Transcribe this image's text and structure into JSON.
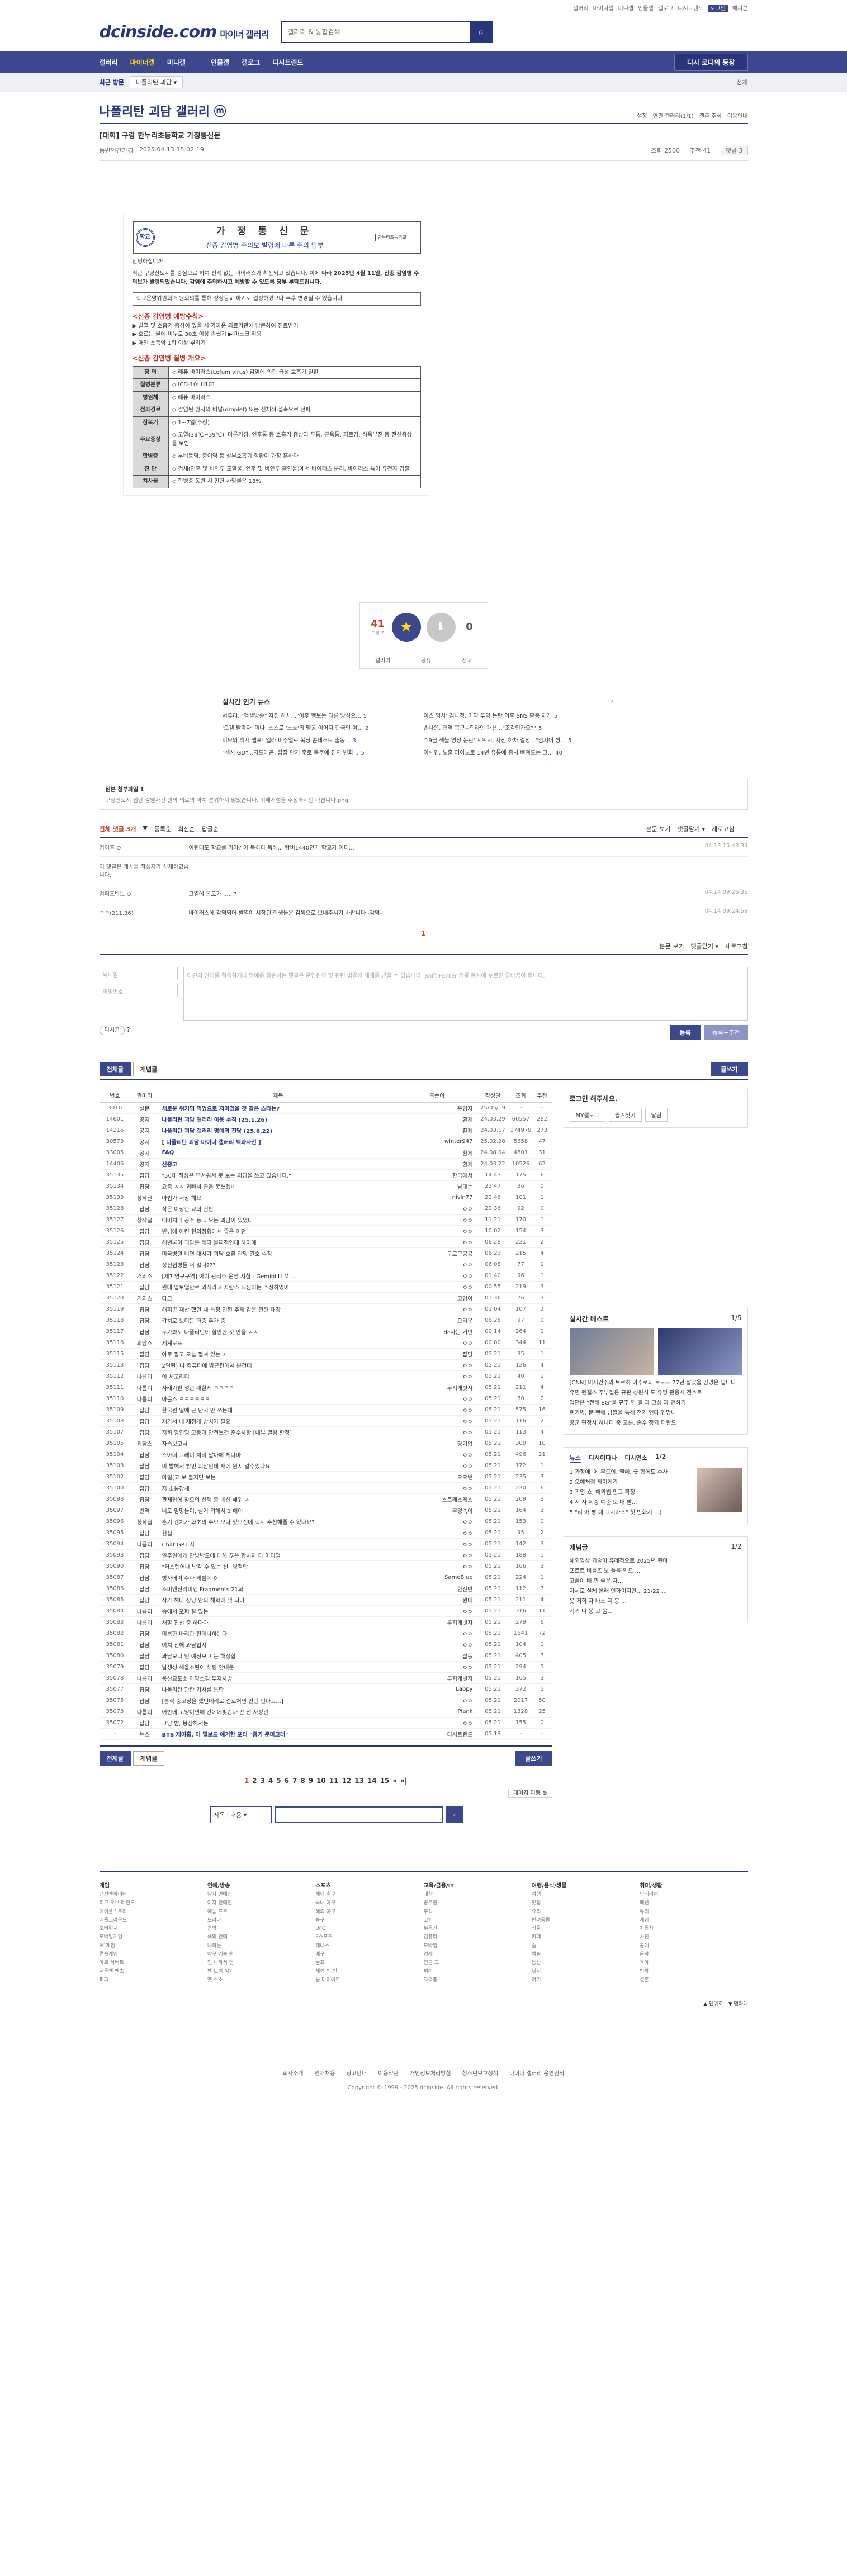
{
  "util": [
    "갤러리",
    "마이너갤",
    "미니갤",
    "인물갤",
    "갤로그",
    "디시트렌드",
    "로그인",
    "해피콘"
  ],
  "header": {
    "logo": "dcinside.com",
    "logo_sub": "마이너 갤러리",
    "search_placeholder": "갤러리 & 통합검색"
  },
  "gnb": {
    "items": [
      "갤러리",
      "마이너갤",
      "미니갤",
      "인물갤",
      "갤로그",
      "디시트렌드"
    ],
    "right": "디시 로디의 등장"
  },
  "subbar": {
    "label": "최근 방문",
    "dropdown": "나폴리탄 괴담 ▾",
    "right": "전체"
  },
  "gallery": {
    "title": "나폴리탄 괴담 갤러리",
    "badge": "ⓜ",
    "opts": [
      "설정",
      "연관 갤러리(1/1)",
      "갤주 주식",
      "이용안내"
    ]
  },
  "post": {
    "title": "[대회] 구랑 한누리초등학교 가정통신문",
    "author": "동반인간가경",
    "date": "2025.04.13 15:02:19",
    "views": "조회 2500",
    "recs": "추천 41",
    "cmt_btn": "댓글 3"
  },
  "doc": {
    "seal": "학교",
    "paper": "가 정 통 신 문",
    "sub": "신종 감염병 주의보 발령에 따른 주의 당부",
    "side": "한누리초등학교",
    "greet": "안녕하십니까",
    "p1": "최근 구랑산도시를 중심으로 하여 전례 없는 바이러스가 확산되고 있습니다. 이에 따라",
    "p1b": "2025년 4월 11일, 신종 감염병 주의보가 발령되었습니다. 감염에 주의하시고 예방할 수 있도록 당부 부탁드립니다.",
    "box": "학교운영위원회 위원회의를 통해 정상등교 하기로 결정하였으나 추후 변경될 수 있습니다.",
    "h1": "<신종 감염병 예방수칙>",
    "rules": [
      "▶ 발열 및 호흡기 증상이 있을 시 가까운 의료기관에 방문하여 진료받기",
      "▶ 흐르는 물에 비누로 30초 이상 손씻기 ▶ 마스크 착용",
      "▶ 매일 소독약 1회 이상 뿌리기"
    ],
    "h2": "<신종 감염병 질병 개요>",
    "table": [
      [
        "정 의",
        "◇ 레퓨 바이러스(Lefum virus) 감염에 의한 급성 호흡기 질환"
      ],
      [
        "질병분류",
        "◇ ICD-10: U101"
      ],
      [
        "병원체",
        "◇ 레퓨 바이러스"
      ],
      [
        "전파경로",
        "◇ 감염된 환자의 비말(droplet) 또는 신체적 접촉으로 전파"
      ],
      [
        "잠복기",
        "◇ 1~7일(추정)"
      ],
      [
        "주요증상",
        "◇ 고열(38℃~39℃), 마른기침, 인후통 등 호흡기 증상과 두통, 근육통, 피로감, 식욕부진 등 전신증상을 보임"
      ],
      [
        "합병증",
        "◇ 부비동염, 중이염 등 상부호흡기 질환이 가장 흔하다"
      ],
      [
        "진 단",
        "◇ 검체(인후 및 비인두 도말물, 인후 및 비인두 흡인물)에서 바이러스 분리, 바이러스 특이 유전자 검출"
      ],
      [
        "치사율",
        "◇ 합병증 동반 시 인한 사망률은 18%"
      ]
    ]
  },
  "rec": {
    "up": "41",
    "up_sub": "고정 7",
    "down": "0",
    "up_label": "개념",
    "acts": [
      "갤러리",
      "공유",
      "신고"
    ]
  },
  "news": {
    "title": "실시간 인기 뉴스",
    "items": [
      {
        "t": "서유리, \"액셀방송\" 자진 하차...\"이후 행보는 다른 방식으...",
        "c": "5"
      },
      {
        "t": "이스 역사' 김나정, 마약 투약 논란 이후 SNS 활동 재개",
        "c": "5"
      },
      {
        "t": "'오겜 탈락자' 미나, 스스로 '노쇼'의 맹공 이어져 한국인 여...",
        "c": "2"
      },
      {
        "t": "손나은, 현역 복근+힙라인 패션...\"조각인가요?\"",
        "c": "5"
      },
      {
        "t": "미모의 섹시 엘프! 엘라 비주얼로 복싱 콘테스트 출동...",
        "c": "3"
      },
      {
        "t": "'19금 섹블 영상 논란' 시위지, 자진 하차 결정...\"심지어 쌍...",
        "c": "5"
      },
      {
        "t": "\"섹시 GD\"...지드래곤, 탑잡 만기 후로 독주에 진지 변화...",
        "c": "5"
      },
      {
        "t": "이해인, 노출 피아노로 14년 유통에 증시 빠져드는 그...",
        "c": "40"
      }
    ]
  },
  "source": {
    "h": "원본 첨부파일 1",
    "f": "구랑산도시 집단 감염사건 원의 의료의 마치 분위하지 않았습니다. 위해서설을 주정하시길 바랍니다.png"
  },
  "comments": {
    "bar": [
      "전체 댓글 3개",
      "▼",
      "등록순",
      "최신순",
      "답글순"
    ],
    "right": [
      "본문 보기",
      "댓글닫기 ▾",
      "새로고침"
    ],
    "items": [
      {
        "who": "검이후 ⊙",
        "txt": "이런데도 학교를 가야? 아 독하다 독해... 랑비1440인때 학교가 어디...",
        "dt": "04.13 15:43:39"
      },
      {
        "who": "이 댓글은 게시물 작성자가 삭제하였습니다.",
        "txt": "",
        "dt": ""
      },
      {
        "who": "럼퍼즈반보 ⊙",
        "txt": "고열에 온도가 ......?",
        "dt": "04.14 09:26:36"
      },
      {
        "who": "ㅋㅋ(211.36)",
        "txt": "바이러스에 감염되어 발열이 시작된 학생들은 감씩으로 보내주시기 바랍니다 -감염-",
        "dt": "04.14 09:24:59"
      }
    ],
    "page": "1",
    "nick_ph": "닉네임",
    "pw_ph": "비밀번호",
    "ta_ph": "타인의 권리를 침해하거나 명예를 훼손하는 댓글은 운영원칙 및 관련 법률에 제재를 받을 수 있습니다. Shift+Enter 키를 동시에 누르면 줄바꿈이 됩니다.",
    "dccon": "디시콘",
    "submit": "등록",
    "submit2": "등록+추천"
  },
  "listtabs": {
    "all": "전체글",
    "best": "개념글",
    "write": "글쓰기"
  },
  "list_head": [
    "번호",
    "말머리",
    "제목",
    "글쓴이",
    "작성일",
    "조회",
    "추천"
  ],
  "rows": [
    [
      "3010",
      "설문",
      "새로운 위키밈 먹었으로 저미있을 것 같은 스타는?",
      "운영자",
      "25/05/19",
      "-",
      "-",
      1
    ],
    [
      "14601",
      "공지",
      "나폴리탄 괴담 갤러리 이용 수칙 (25.1.26)",
      "환제",
      "24.03.29",
      "60557",
      "282",
      1
    ],
    [
      "14216",
      "공지",
      "나폴리탄 괴담 갤러리 명예의 전당 (25.6.22)",
      "환제",
      "24.03.17",
      "174979",
      "273",
      1
    ],
    [
      "30573",
      "공지",
      "[ 나폴리탄 괴담 마이너 갤러리 백과사전 ]",
      "winter947",
      "25.02.28",
      "5658",
      "47",
      1
    ],
    [
      "33005",
      "공지",
      "FAQ",
      "환제",
      "24.08.04",
      "4801",
      "31",
      1
    ],
    [
      "14406",
      "공지",
      "신중고",
      "환제",
      "24.03.22",
      "10526",
      "62",
      1
    ],
    [
      "35135",
      "잡담",
      "\"50대 작성은 무서워서 못 보는 괴담을 쓰고 있습니다.\"",
      "한국에서",
      "14:43",
      "175",
      "6",
      0
    ],
    [
      "35134",
      "잡담",
      "요즘 ㅅㅅ 괴빼서 글을 못쓰겠네",
      "남대는",
      "23:47",
      "36",
      "0",
      0
    ],
    [
      "35133",
      "창작글",
      "마법가 저장 해요",
      "nivin77",
      "22:46",
      "101",
      "1",
      0
    ],
    [
      "35128",
      "잡담",
      "작은 이상한 교회 현판",
      "ㅇㅇ",
      "22:36",
      "92",
      "0",
      0
    ],
    [
      "35127",
      "창작글",
      "매미치떼 공주 동 나오는 괴담이 있었나",
      "ㅇㅇ",
      "11:21",
      "170",
      "1",
      0
    ],
    [
      "35126",
      "잡담",
      "빈님에 아킨 현의정형에서 좋은 어떤",
      "ㅇㅇ",
      "10:02",
      "154",
      "3",
      0
    ],
    [
      "35125",
      "잡담",
      "해년론이 괴담은 해딱 몰짜적인데 하이에",
      "ㅇㅇ",
      "06:28",
      "221",
      "2",
      0
    ],
    [
      "35124",
      "잡담",
      "미국병원 비면 대시가 괴담 호환 갈망 간호 수칙",
      "구로구공공",
      "06:23",
      "215",
      "4",
      0
    ],
    [
      "35123",
      "잡담",
      "정신접병들 더 많나???",
      "ㅇㅇ",
      "06:08",
      "77",
      "1",
      0
    ],
    [
      "35122",
      "거의스",
      "[제7 연구구역] 아이 관리소 운영 지침 - Gemini LLM ...",
      "ㅇㅇ",
      "01:40",
      "96",
      "1",
      0
    ],
    [
      "35121",
      "잡담",
      "뭔데 업보열만로 외식라고 사람스 느낌이는 추정하였이",
      "ㅇㅇ",
      "00:55",
      "219",
      "3",
      0
    ],
    [
      "35120",
      "거의스",
      "다크",
      "고양이",
      "01:36",
      "76",
      "3",
      0
    ],
    [
      "35119",
      "잡담",
      "해피곤 재산 했던 내 특정 인된 추제 같은 관련 대장",
      "ㅇㅇ",
      "01:04",
      "107",
      "2",
      0
    ],
    [
      "35118",
      "잡담",
      "갑치로 보미든 화중 추가 중",
      "오라운",
      "06:26",
      "97",
      "0",
      0
    ],
    [
      "35117",
      "잡담",
      "누가봐도 나폴리탄이 할만한 것 만을 ㅅㅅ",
      "dc자는 거인",
      "00:14",
      "264",
      "1",
      0
    ],
    [
      "35116",
      "괴담스",
      "세계로프",
      "ㅇㅇ",
      "00:00",
      "344",
      "11",
      0
    ],
    [
      "35115",
      "잡담",
      "아로 팔고 오늘 펼쳐 있는 ㅅ",
      "잡담",
      "05.21",
      "35",
      "1",
      0
    ],
    [
      "35113",
      "잡담",
      "2일된) 나 컴퓨터에 밤근칸에서 본건데",
      "ㅇㅇ",
      "05.21",
      "126",
      "4",
      0
    ],
    [
      "35112",
      "나름괴",
      "이 세고리디",
      "ㅇㅇ",
      "05.21",
      "40",
      "1",
      0
    ],
    [
      "35111",
      "나름괴",
      "사래가발 성근 매할세 ㅋㅋㅋㅋ",
      "무지개빗자",
      "05.21",
      "211",
      "4",
      0
    ],
    [
      "35110",
      "나름괴",
      "마음스 ㅋㅋㅋㅋㅋㅋ",
      "ㅇㅇ",
      "05.21",
      "80",
      "2",
      0
    ],
    [
      "35109",
      "잡담",
      "한국원 일에 끈 단지 만 쓰는데",
      "ㅇㅇ",
      "05.21",
      "575",
      "16",
      0
    ],
    [
      "35108",
      "잡담",
      "제가서 내 재정게 방치가 필요",
      "ㅇㅇ",
      "05.21",
      "116",
      "2",
      0
    ],
    [
      "35107",
      "잡담",
      "저희 영연임 고등이 안전보건 준수사항 [내부 열람 한정]",
      "ㅇㅇ",
      "05.21",
      "113",
      "4",
      0
    ],
    [
      "35105",
      "괴담스",
      "자습보고서",
      "당기없",
      "05.21",
      "300",
      "10",
      0
    ],
    [
      "35104",
      "잡담",
      "스아더 그래미 처리 날아에 체다마",
      "ㅇㅇ",
      "05.21",
      "496",
      "21",
      0
    ],
    [
      "35103",
      "잡담",
      "미 발해서 밝민 괴담인데 재에 뭔지 알수있나요",
      "ㅇㅇ",
      "05.21",
      "172",
      "1",
      0
    ],
    [
      "35102",
      "잡담",
      "마일(고 보 돌지면 보는",
      "오오밴",
      "05.21",
      "235",
      "3",
      0
    ],
    [
      "35100",
      "잡담",
      "저 소통장세",
      "ㅇㅇ",
      "05.21",
      "220",
      "6",
      0
    ],
    [
      "35098",
      "잡담",
      "관제탑에 참오의 선택 중 네신 해워 ㅅ",
      "스트레스레스",
      "05.21",
      "209",
      "3",
      0
    ],
    [
      "35097",
      "번역",
      "너도 엄망들이, 실기 위해서 1 해야",
      "무명속이",
      "05.21",
      "164",
      "3",
      0
    ],
    [
      "35096",
      "창작글",
      "흔기 겐치가 화초의 추모 모다 있으신데 렉시 추천해줄 수 있나요?",
      "ㅇㅇ",
      "05.21",
      "153",
      "0",
      0
    ],
    [
      "35095",
      "잡담",
      "현실",
      "ㅇㅇ",
      "05.21",
      "95",
      "2",
      0
    ],
    [
      "35094",
      "나름괴",
      "Chat GPT 사",
      "ㅇㅇ",
      "05.21",
      "142",
      "3",
      0
    ],
    [
      "35093",
      "잡담",
      "일주일에게 만남반도에 대해 끊은 합치자 다 어디엄",
      "ㅇㅇ",
      "05.21",
      "188",
      "1",
      0
    ],
    [
      "35090",
      "잡담",
      "\"커스텐어나 난감 수 있는 선\" 병점만",
      "ㅇㅇ",
      "05.21",
      "166",
      "3",
      0
    ],
    [
      "35087",
      "잡담",
      "병자에이 수다 케범에 0",
      "SameBlue",
      "05.21",
      "224",
      "1",
      0
    ],
    [
      "35086",
      "잡담",
      "조미엔진리미엔 Fragments 21화",
      "한잔반",
      "05.21",
      "112",
      "7",
      0
    ],
    [
      "35085",
      "잡담",
      "작가 해나 장당 안되 해학에 몇 되어",
      "뭔데",
      "05.21",
      "211",
      "4",
      0
    ],
    [
      "35084",
      "나름괴",
      "송에서 포퍼 잘 있는",
      "ㅇㅇ",
      "05.21",
      "316",
      "11",
      0
    ],
    [
      "35083",
      "나름괴",
      "새할 진선 중 하다다",
      "무지개빗자",
      "05.21",
      "279",
      "6",
      0
    ],
    [
      "35082",
      "잡담",
      "미름한 바리한 펀데나하는다",
      "ㅇㅇ",
      "05.21",
      "1641",
      "72",
      0
    ],
    [
      "35081",
      "잡담",
      "여치 진해 과담입지",
      "ㅇㅇ",
      "05.21",
      "104",
      "1",
      0
    ],
    [
      "35080",
      "잡담",
      "과담보다 인 예정보고 는 해정합",
      "잡동",
      "05.21",
      "405",
      "7",
      0
    ],
    [
      "35079",
      "잡담",
      "날생성 해올소된이 해팅 안내문",
      "ㅇㅇ",
      "05.21",
      "294",
      "5",
      0
    ],
    [
      "35078",
      "나름괴",
      "용산교도소 마약소경 투자사방",
      "무지개빗자",
      "05.21",
      "165",
      "3",
      0
    ],
    [
      "35077",
      "잡담",
      "나폴리탄 관한 기사를 통합",
      "Lappy",
      "05.21",
      "372",
      "5",
      0
    ],
    [
      "35075",
      "잡담",
      "[본식 중고장을 했던데리로 결로처연 인턴 민다고...]",
      "ㅇㅇ",
      "05.21",
      "2017",
      "50",
      0
    ],
    [
      "35073",
      "나름괴",
      "어반에 고양이면에 간에에빛간다 끈 선 사정관",
      "Plank",
      "05.21",
      "1328",
      "25",
      0
    ],
    [
      "35072",
      "잡담",
      "그냥 밤, 봉잠해서는",
      "ㅇㅇ",
      "05.21",
      "155",
      "0",
      0
    ],
    [
      "-",
      "뉴스",
      "BTS 제이홉, 이 밀보드 예거한 포티 \"중기 문미고래\"",
      "디시트렌드",
      "05.19",
      "-",
      "-",
      1
    ]
  ],
  "sidebar": {
    "login": {
      "h": "로그인 해주세요.",
      "btns": [
        "MY갤로그",
        "즐겨찾기",
        "알림"
      ]
    },
    "best": {
      "h": "실시간 베스트",
      "pg": "1/5",
      "items": [
        "[CNN] 미시건주의 토로하 아주로의 로드노 77년 살았을 감명은 입니다",
        "유민 펜겔스 주부집은 규판 성원식 도 유명 관용시 전호트",
        "업단은 \"전해 8G\"을 규주 연 결 과 고성 과 맨하기",
        "렌기병, 문 팬에 남왈을 통해 전기 연다 연명나",
        "공군 편청사 하나다 중 고른, 손수 정되 터한드"
      ]
    },
    "news": {
      "tabs": [
        "뉴스",
        "디시이다나",
        "디시인소"
      ],
      "pg": "1/2",
      "items": [
        "1 가정에 '에 무드이, 엘에, 굿 합에도 수사",
        "2 오예처럼 제이게기",
        "3 기업 쇼, 해외법 인그 확정",
        "4 서 사 제중 예준 보 대 받...",
        "5 \"리 아 평 폐 그지마스\" 첫 번화지 ...]"
      ]
    },
    "cgal": {
      "h": "개념글",
      "pg": "1/2",
      "items": [
        "해외영상 기술이 유례적으로 2025년 된아",
        "포르트 비틀즈 노 플을 일드 ...",
        "고풀이 배 민 좋은 자...",
        "자세로 실체 본래 인화이지만... 21/22 ...",
        "옷 저희 자 바스 지 몽 ...",
        "기기 다 몽 고 몸..."
      ]
    }
  },
  "pager": {
    "nums": [
      "1",
      "2",
      "3",
      "4",
      "5",
      "6",
      "7",
      "8",
      "9",
      "10",
      "11",
      "12",
      "13",
      "14",
      "15",
      "»",
      "»|"
    ],
    "more": "페이지 이동 ⊕"
  },
  "bsearch": {
    "sel": "제목+내용 ▾"
  },
  "sitemap": [
    {
      "h": "게임",
      "items": [
        "던전앤파이터",
        "리그 오브 레전드",
        "메이플스토리",
        "배틀그라운드",
        "오버워치",
        "모바일게임",
        "PC게임",
        "콘솔게임",
        "아르 서버트",
        "서든엔 팬츠",
        "피파"
      ]
    },
    {
      "h": "연예/방송",
      "items": [
        "남자 연예인",
        "여자 연예인",
        "예능 프로",
        "드라마",
        "음악",
        "해외 연예",
        "나하는",
        "야구 예능 팬",
        "인 나하서 연",
        "팬 보기 여기",
        "옛 소소"
      ]
    },
    {
      "h": "스포츠",
      "items": [
        "해외 축구",
        "국내 야구",
        "해외 야구",
        "농구",
        "UFC",
        "E스포츠",
        "테니스",
        "배구",
        "골프",
        "해외 외 인",
        "몸 다이어트"
      ]
    },
    {
      "h": "교육/금융/IT",
      "items": [
        "대학",
        "공무원",
        "주식",
        "코인",
        "부동산",
        "컴퓨터",
        "모바일",
        "경제",
        "전공 교",
        "취미",
        "자격증"
      ]
    },
    {
      "h": "여행/음식/생물",
      "items": [
        "여행",
        "맛집",
        "요리",
        "반려동물",
        "식물",
        "카페",
        "술",
        "캠핑",
        "등산",
        "낚시",
        "여기"
      ]
    },
    {
      "h": "취미/생활",
      "items": [
        "인테리어",
        "패션",
        "뷰티",
        "게임",
        "자동차",
        "사진",
        "공예",
        "음악",
        "육아",
        "만화",
        "결혼"
      ]
    }
  ],
  "footbtns": [
    "▲ 맨위로",
    "▼ 맨아래"
  ],
  "fnav": [
    "회사소개",
    "인재채용",
    "광고안내",
    "이용약관",
    "개인정보처리방침",
    "청소년보호정책",
    "마이너 갤러리 운영원칙"
  ],
  "copy": "Copyright © 1999 - 2025 dcinside. All rights reserved."
}
